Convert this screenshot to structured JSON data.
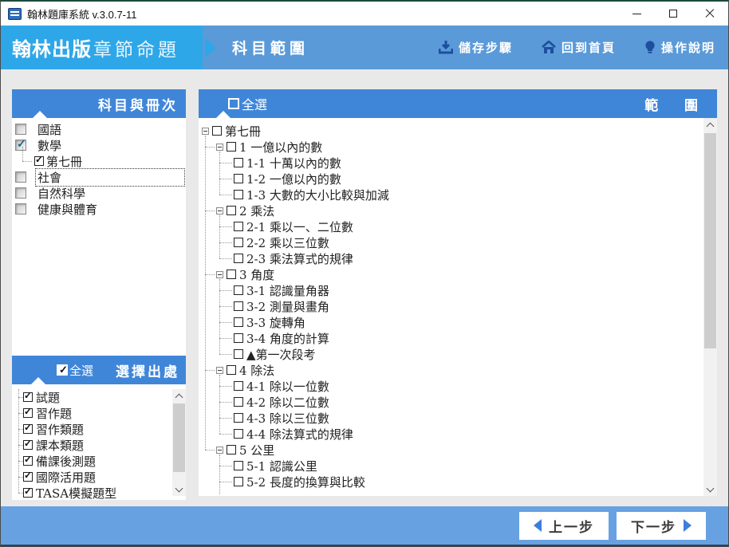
{
  "window": {
    "title": "翰林題庫系統 v.3.0.7-11"
  },
  "header": {
    "brand": "翰林出版",
    "brand_sub": "章節命題",
    "page_title": "科目範圍",
    "actions": [
      {
        "label": "儲存步驟",
        "icon": "save-icon"
      },
      {
        "label": "回到首頁",
        "icon": "home-icon"
      },
      {
        "label": "操作說明",
        "icon": "lightbulb-icon"
      }
    ]
  },
  "subjects_panel": {
    "title": "科目與冊次",
    "items": [
      {
        "label": "國語",
        "checked": false,
        "level": 0
      },
      {
        "label": "數學",
        "checked": true,
        "level": 0
      },
      {
        "label": "第七冊",
        "checked": true,
        "level": 1
      },
      {
        "label": "社會",
        "checked": false,
        "level": 0,
        "focused": true
      },
      {
        "label": "自然科學",
        "checked": false,
        "level": 0
      },
      {
        "label": "健康與體育",
        "checked": false,
        "level": 0
      }
    ]
  },
  "sources_panel": {
    "select_all_label": "全選",
    "select_all_checked": true,
    "title": "選擇出處",
    "items": [
      {
        "label": "試題",
        "checked": true
      },
      {
        "label": "習作題",
        "checked": true
      },
      {
        "label": "習作類題",
        "checked": true
      },
      {
        "label": "課本類題",
        "checked": true
      },
      {
        "label": "備課後測題",
        "checked": true
      },
      {
        "label": "國際活用題",
        "checked": true
      },
      {
        "label": "TASA模擬題型",
        "checked": true
      }
    ]
  },
  "scope_panel": {
    "select_all_label": "全選",
    "select_all_checked": false,
    "title": "範 圍",
    "tree": [
      {
        "label": "第七冊",
        "level": 0,
        "expanded": true,
        "checked": false
      },
      {
        "label": "1 一億以內的數",
        "level": 1,
        "expanded": true,
        "checked": false
      },
      {
        "label": "1-1 十萬以內的數",
        "level": 2,
        "checked": false
      },
      {
        "label": "1-2 一億以內的數",
        "level": 2,
        "checked": false
      },
      {
        "label": "1-3 大數的大小比較與加減",
        "level": 2,
        "checked": false
      },
      {
        "label": "2 乘法",
        "level": 1,
        "expanded": true,
        "checked": false
      },
      {
        "label": "2-1 乘以一、二位數",
        "level": 2,
        "checked": false
      },
      {
        "label": "2-2 乘以三位數",
        "level": 2,
        "checked": false
      },
      {
        "label": "2-3 乘法算式的規律",
        "level": 2,
        "checked": false
      },
      {
        "label": "3 角度",
        "level": 1,
        "expanded": true,
        "checked": false
      },
      {
        "label": "3-1 認識量角器",
        "level": 2,
        "checked": false
      },
      {
        "label": "3-2 測量與畫角",
        "level": 2,
        "checked": false
      },
      {
        "label": "3-3 旋轉角",
        "level": 2,
        "checked": false
      },
      {
        "label": "3-4 角度的計算",
        "level": 2,
        "checked": false
      },
      {
        "label": "▲第一次段考",
        "level": 2,
        "checked": false
      },
      {
        "label": "4 除法",
        "level": 1,
        "expanded": true,
        "checked": false
      },
      {
        "label": "4-1 除以一位數",
        "level": 2,
        "checked": false
      },
      {
        "label": "4-2 除以二位數",
        "level": 2,
        "checked": false
      },
      {
        "label": "4-3 除以三位數",
        "level": 2,
        "checked": false
      },
      {
        "label": "4-4 除法算式的規律",
        "level": 2,
        "checked": false
      },
      {
        "label": "5 公里",
        "level": 1,
        "expanded": true,
        "checked": false
      },
      {
        "label": "5-1 認識公里",
        "level": 2,
        "checked": false
      },
      {
        "label": "5-2 長度的換算與比較",
        "level": 2,
        "checked": false
      }
    ]
  },
  "footer": {
    "prev_label": "上一步",
    "next_label": "下一步"
  },
  "colors": {
    "header_blue": "#5b9ad8",
    "tab_blue": "#2ea7e8",
    "panel_header_blue": "#4086d8",
    "footer_blue": "#68a1e2",
    "icon_navy": "#1d4f9e",
    "background_gray": "#e9e9e9"
  }
}
